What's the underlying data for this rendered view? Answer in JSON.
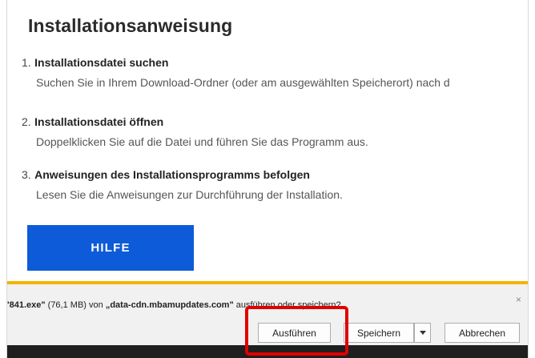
{
  "page": {
    "title": "Installationsanweisung"
  },
  "steps": [
    {
      "num": "1.",
      "title": "Installationsdatei suchen",
      "desc": "Suchen Sie in Ihrem Download-Ordner (oder am ausgewählten Speicherort) nach d"
    },
    {
      "num": "2.",
      "title": "Installationsdatei öffnen",
      "desc": "Doppelklicken Sie auf die Datei und führen Sie das Programm aus."
    },
    {
      "num": "3.",
      "title": "Anweisungen des Installationsprogramms befolgen",
      "desc": "Lesen Sie die Anweisungen zur Durchführung der Installation."
    }
  ],
  "help_button": {
    "label": "HILFE"
  },
  "download_bar": {
    "accent_color": "#f5b400",
    "file_name": "'841.exe\"",
    "size_text": "(76,1 MB) von",
    "source": "„data-cdn.mbamupdates.com\"",
    "action_text": "ausführen oder speichern?",
    "close_label": "×",
    "run_label": "Ausführen",
    "save_label": "Speichern",
    "cancel_label": "Abbrechen"
  },
  "colors": {
    "help_button": "#0d5bd8",
    "highlight_box": "#e00000"
  }
}
